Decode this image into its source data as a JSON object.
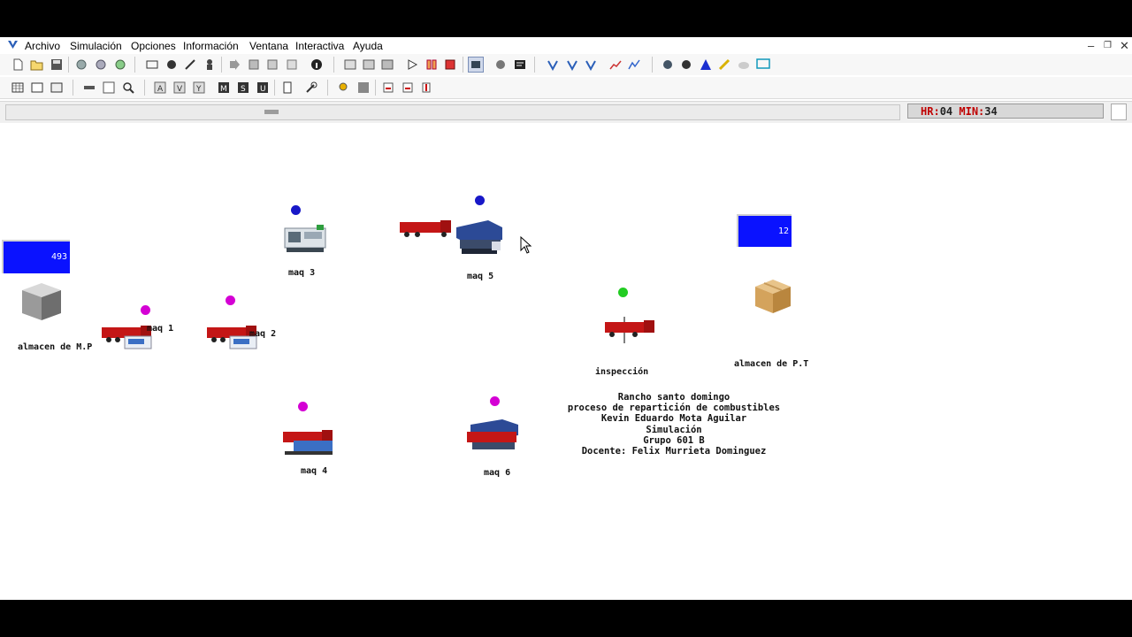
{
  "menu": {
    "items": [
      "Archivo",
      "Simulación",
      "Opciones",
      "Información",
      "Ventana",
      "Interactiva",
      "Ayuda"
    ]
  },
  "colors": {
    "counter_blue": "#0a12ff",
    "dot_blue": "#1818c8",
    "dot_magenta": "#d400d4",
    "dot_green": "#22cc22",
    "truck_red": "#c41616",
    "clock_red": "#c00000"
  },
  "clock": {
    "hr_label": "HR:",
    "hr_value": "04",
    "min_label": "MIN:",
    "min_value": "34"
  },
  "stations": {
    "almacen_mp": {
      "label": "almacen de M.P",
      "count": "493",
      "icon": "gray-cube-icon"
    },
    "maq1": {
      "label": "maq 1",
      "icon": "truck-machine-icon"
    },
    "maq2": {
      "label": "maq 2",
      "icon": "truck-machine-icon"
    },
    "maq3": {
      "label": "maq 3",
      "icon": "lathe-machine-icon"
    },
    "maq4": {
      "label": "maq 4",
      "icon": "truck-machine-icon"
    },
    "maq5": {
      "label": "maq 5",
      "icon": "bandsaw-machine-icon"
    },
    "maq6": {
      "label": "maq 6",
      "icon": "bandsaw-truck-icon"
    },
    "inspeccion": {
      "label": "inspección",
      "icon": "truck-icon"
    },
    "almacen_pt": {
      "label": "almacen de P.T",
      "count": "12",
      "icon": "cardboard-box-icon"
    }
  },
  "info": {
    "line1": "Rancho santo domingo",
    "line2": "proceso de repartición de combustibles",
    "line3": "Kevin Eduardo Mota Aguilar",
    "line4": "Simulación",
    "line5": "Grupo 601 B",
    "line6": "Docente: Felix Murrieta Dominguez"
  }
}
